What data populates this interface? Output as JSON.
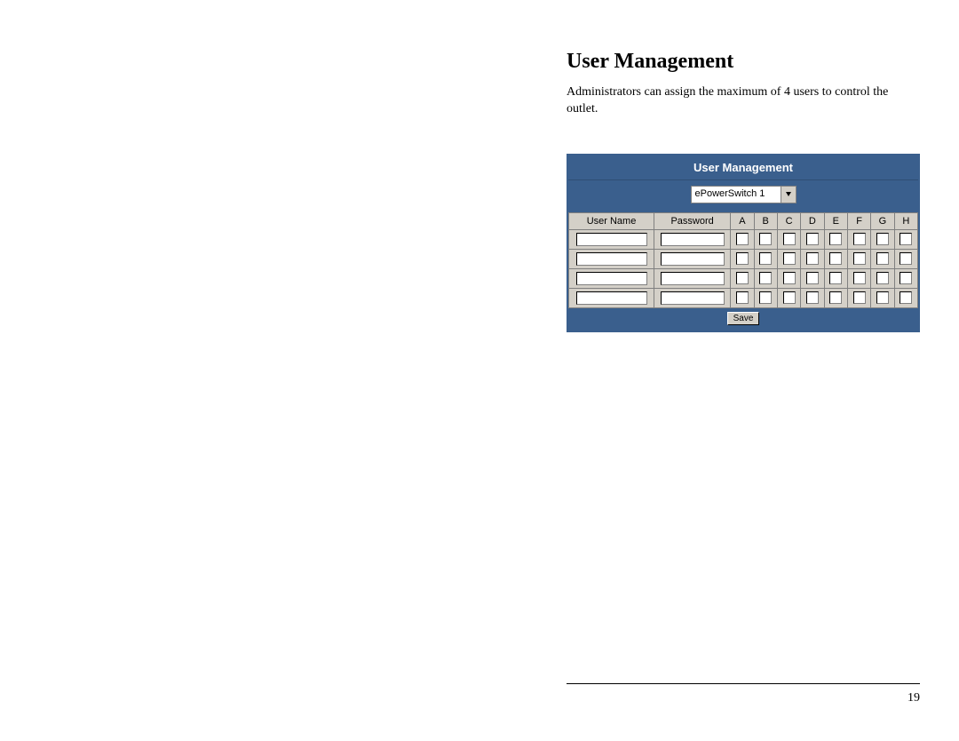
{
  "heading": "User Management",
  "intro": "Administrators can assign the maximum of 4 users to control the outlet.",
  "panel": {
    "title": "User Management",
    "device_selected": "ePowerSwitch 1",
    "columns": {
      "user": "User Name",
      "pass": "Password"
    },
    "outlet_headers": [
      "A",
      "B",
      "C",
      "D",
      "E",
      "F",
      "G",
      "H"
    ],
    "rows": [
      {
        "user": "",
        "pass": "",
        "outlets": [
          false,
          false,
          false,
          false,
          false,
          false,
          false,
          false
        ]
      },
      {
        "user": "",
        "pass": "",
        "outlets": [
          false,
          false,
          false,
          false,
          false,
          false,
          false,
          false
        ]
      },
      {
        "user": "",
        "pass": "",
        "outlets": [
          false,
          false,
          false,
          false,
          false,
          false,
          false,
          false
        ]
      },
      {
        "user": "",
        "pass": "",
        "outlets": [
          false,
          false,
          false,
          false,
          false,
          false,
          false,
          false
        ]
      }
    ],
    "save_label": "Save"
  },
  "page_number": "19"
}
